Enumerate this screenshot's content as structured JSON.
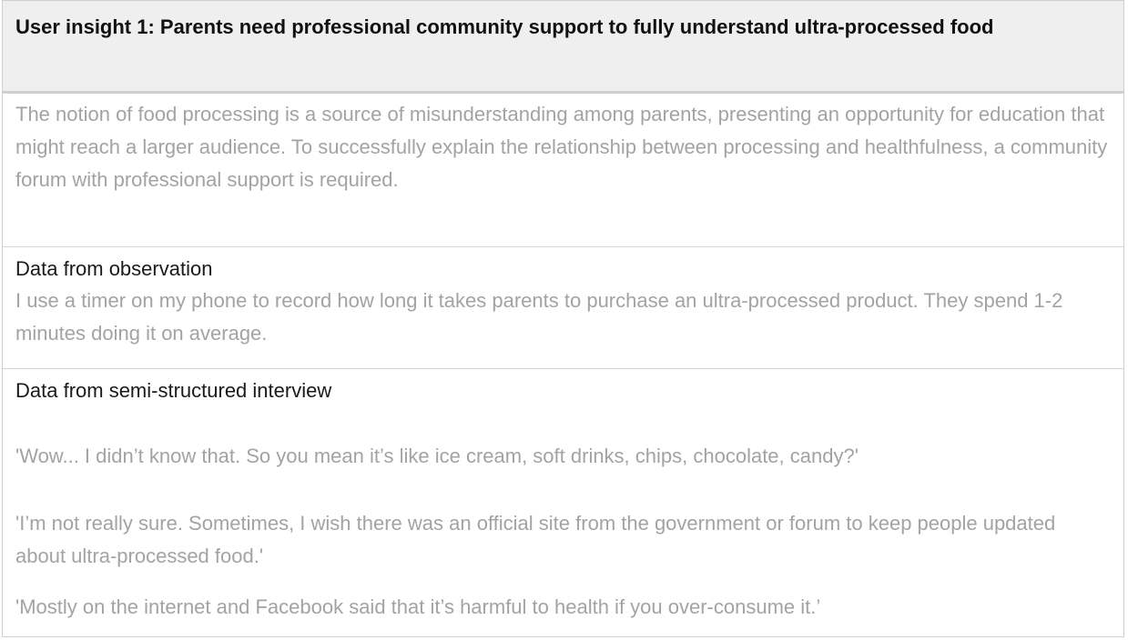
{
  "insight": {
    "title": "User insight 1: Parents need professional community support to fully understand ultra-processed food"
  },
  "summary": {
    "text": "The notion of food processing is a source of misunderstanding among parents, presenting an opportunity for education that might reach a larger audience. To successfully explain the relationship between processing and healthfulness, a community forum with professional support is required."
  },
  "observation": {
    "label": "Data from observation",
    "text": "I use a timer on my phone to record how long it takes parents to purchase an ultra-processed product. They spend 1-2 minutes doing it on average."
  },
  "interview": {
    "label": "Data from semi-structured interview",
    "quotes": [
      "'Wow... I didn’t know that. So you mean it’s like ice cream, soft drinks, chips, chocolate, candy?'",
      "'I’m not really sure. Sometimes, I wish there was an official site from the government or forum to keep people updated about ultra-processed food.'",
      "'Mostly on the internet and Facebook said that it’s harmful to health if you over-consume it.’"
    ]
  },
  "colors": {
    "header_bg": "#efefef",
    "border": "#cfcfcf",
    "muted_text": "#a3a3a3",
    "label_text": "#1a1a1a"
  }
}
